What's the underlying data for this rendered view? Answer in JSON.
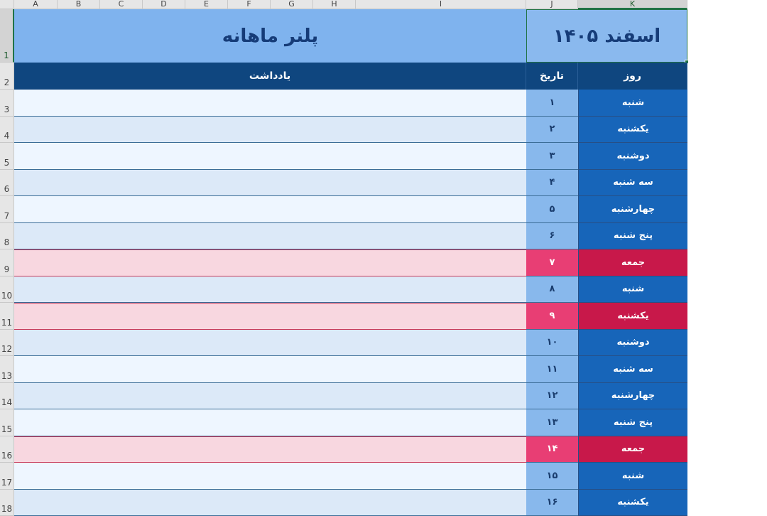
{
  "columns": [
    "A",
    "B",
    "C",
    "D",
    "E",
    "F",
    "G",
    "H",
    "I",
    "J",
    "K"
  ],
  "sheet_title": "پلنر ماهانه",
  "month_title": "اسفند ۱۴۰۵",
  "headers": {
    "note": "یادداشت",
    "date": "تاریخ",
    "day": "روز"
  },
  "row_numbers": [
    "1",
    "2",
    "3",
    "4",
    "5",
    "6",
    "7",
    "8",
    "9",
    "10",
    "11",
    "12",
    "13",
    "14",
    "15",
    "16",
    "17",
    "18"
  ],
  "rows": [
    {
      "date": "۱",
      "day": "شنبه",
      "holiday": false,
      "note": ""
    },
    {
      "date": "۲",
      "day": "یکشنبه",
      "holiday": false,
      "note": ""
    },
    {
      "date": "۳",
      "day": "دوشنبه",
      "holiday": false,
      "note": ""
    },
    {
      "date": "۴",
      "day": "سه شنبه",
      "holiday": false,
      "note": ""
    },
    {
      "date": "۵",
      "day": "چهارشنبه",
      "holiday": false,
      "note": ""
    },
    {
      "date": "۶",
      "day": "پنج شنبه",
      "holiday": false,
      "note": ""
    },
    {
      "date": "۷",
      "day": "جمعه",
      "holiday": true,
      "note": ""
    },
    {
      "date": "۸",
      "day": "شنبه",
      "holiday": false,
      "note": ""
    },
    {
      "date": "۹",
      "day": "یکشنبه",
      "holiday": true,
      "note": ""
    },
    {
      "date": "۱۰",
      "day": "دوشنبه",
      "holiday": false,
      "note": ""
    },
    {
      "date": "۱۱",
      "day": "سه شنبه",
      "holiday": false,
      "note": ""
    },
    {
      "date": "۱۲",
      "day": "چهارشنبه",
      "holiday": false,
      "note": ""
    },
    {
      "date": "۱۳",
      "day": "پنج شنبه",
      "holiday": false,
      "note": ""
    },
    {
      "date": "۱۴",
      "day": "جمعه",
      "holiday": true,
      "note": ""
    },
    {
      "date": "۱۵",
      "day": "شنبه",
      "holiday": false,
      "note": ""
    },
    {
      "date": "۱۶",
      "day": "یکشنبه",
      "holiday": false,
      "note": ""
    }
  ]
}
